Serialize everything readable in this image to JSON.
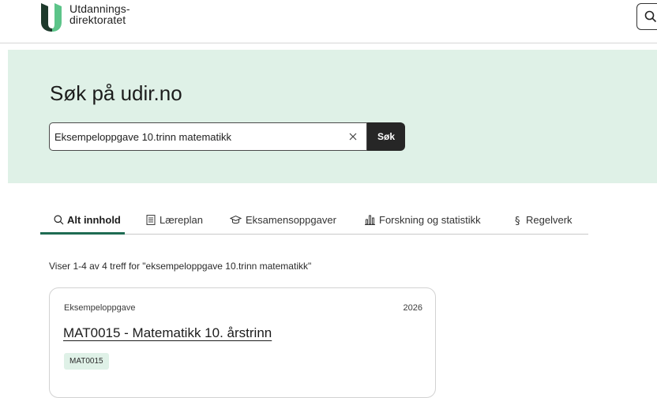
{
  "header": {
    "logo_line1": "Utdannings-",
    "logo_line2": "direktoratet",
    "search_icon": "search-icon"
  },
  "hero": {
    "title": "Søk på udir.no",
    "search_value": "Eksempeloppgave 10.trinn matematikk",
    "clear_icon": "close-icon",
    "search_button": "Søk"
  },
  "tabs": [
    {
      "label": "Alt innhold",
      "icon": "search-icon",
      "active": true
    },
    {
      "label": "Læreplan",
      "icon": "document-icon",
      "active": false
    },
    {
      "label": "Eksamensoppgaver",
      "icon": "graduation-cap-icon",
      "active": false
    },
    {
      "label": "Forskning og statistikk",
      "icon": "bar-chart-icon",
      "active": false
    },
    {
      "label": "Regelverk",
      "icon": "paragraph-icon",
      "active": false
    }
  ],
  "results": {
    "count_text": "Viser 1-4 av 4 treff for \"eksempeloppgave 10.trinn matematikk\"",
    "items": [
      {
        "type": "Eksempeloppgave",
        "year": "2026",
        "title": "MAT0015 - Matematikk 10. årstrinn",
        "tag": "MAT0015"
      }
    ]
  },
  "colors": {
    "hero_bg": "#dff1e7",
    "accent": "#1e6b52",
    "button_bg": "#262626",
    "logo_dark": "#1e3a2c",
    "logo_light": "#5cc489"
  }
}
